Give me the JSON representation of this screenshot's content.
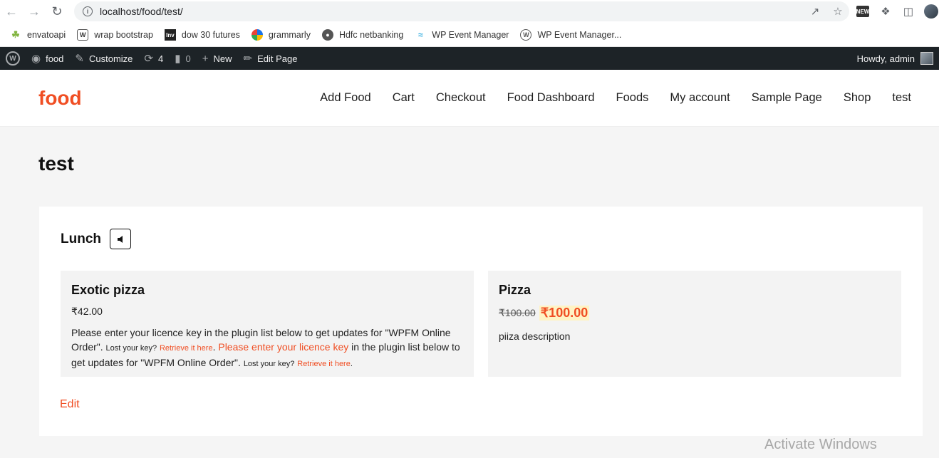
{
  "browser": {
    "url": "localhost/food/test/",
    "bookmarks": [
      {
        "label": "envatoapi",
        "icon": "envato-icon"
      },
      {
        "label": "wrap bootstrap",
        "icon": "w-icon"
      },
      {
        "label": "dow 30 futures",
        "icon": "inv-icon"
      },
      {
        "label": "grammarly",
        "icon": "grammarly-icon"
      },
      {
        "label": "Hdfc netbanking",
        "icon": "globe-icon"
      },
      {
        "label": "WP Event Manager",
        "icon": "wpem-icon"
      },
      {
        "label": "WP Event Manager...",
        "icon": "wordpress-icon"
      }
    ],
    "ext_badge": "NEW"
  },
  "adminbar": {
    "site": "food",
    "customize": "Customize",
    "updates": "4",
    "comments": "0",
    "new": "New",
    "edit_page": "Edit Page",
    "howdy": "Howdy, admin"
  },
  "site": {
    "title": "food",
    "nav": [
      "Add Food",
      "Cart",
      "Checkout",
      "Food Dashboard",
      "Foods",
      "My account",
      "Sample Page",
      "Shop",
      "test"
    ]
  },
  "page": {
    "title": "test",
    "menu_title": "Lunch",
    "items": [
      {
        "name": "Exotic pizza",
        "price": "₹42.00",
        "desc_part1": "Please enter your licence key in the plugin list below to get updates for \"WPFM Online Order\".",
        "lost_key_1": "Lost your key?",
        "retrieve_1": "Retrieve it here",
        "period_1": ". ",
        "please_link": "Please enter your licence key",
        "desc_part2": " in the plugin list below to get updates for \"WPFM Online Order\".",
        "lost_key_2": "Lost your key?",
        "retrieve_2": "Retrieve it here",
        "period_2": "."
      },
      {
        "name": "Pizza",
        "old_price": "₹100.00",
        "new_price": "₹100.00",
        "desc": "piiza description"
      }
    ],
    "edit": "Edit"
  },
  "watermark": "Activate Windows",
  "colors": {
    "accent": "#f04e23",
    "adminbar": "#1d2327"
  }
}
